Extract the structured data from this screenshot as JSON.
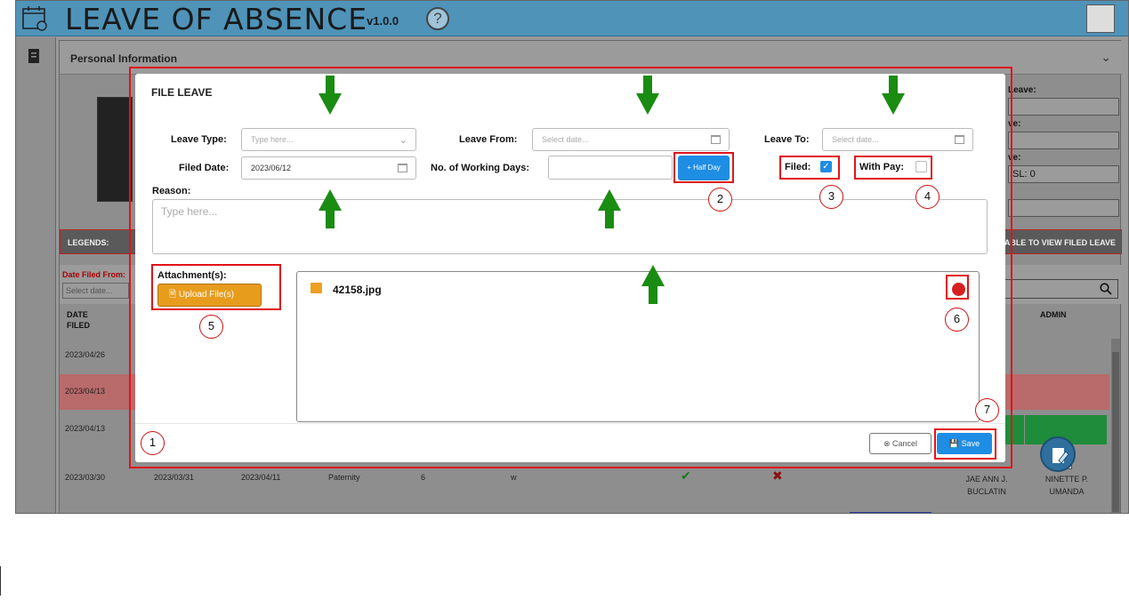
{
  "app": {
    "title": "LEAVE OF ABSENCE",
    "version": "v1.0.0",
    "help": "?"
  },
  "personal": {
    "title": "Personal Information",
    "right_labels": [
      "Leave:",
      "ve:",
      "ve:"
    ],
    "sl_value": "SL: 0"
  },
  "legends": {
    "label": "LEGENDS:",
    "hint": "TABLE TO VIEW FILED LEAVE"
  },
  "filter": {
    "label": "Date Filed From:",
    "placeholder": "Select date..."
  },
  "table": {
    "headers": {
      "date_filed": "DATE FILED",
      "admin": "ADMIN"
    },
    "rows": [
      {
        "date": "2023/04/26"
      },
      {
        "date": "2023/04/13"
      },
      {
        "date": "2023/04/13"
      },
      {
        "date": "2023/03/30",
        "from": "2023/03/31",
        "to": "2023/04/11",
        "type": "Paternity",
        "days": "6",
        "pay": "w",
        "approver": "JAE ANN J. BUCLATIN",
        "admin": "NINETTE P. UMANDA"
      }
    ]
  },
  "modal": {
    "title": "FILE LEAVE",
    "leave_type": {
      "label": "Leave Type:",
      "placeholder": "Type here..."
    },
    "leave_from": {
      "label": "Leave From:",
      "placeholder": "Select date..."
    },
    "leave_to": {
      "label": "Leave To:",
      "placeholder": "Select date..."
    },
    "filed_date": {
      "label": "Filed Date:",
      "value": "2023/06/12"
    },
    "working_days": {
      "label": "No. of Working Days:",
      "value": ""
    },
    "half_day": "+ Half Day",
    "filed": {
      "label": "Filed:",
      "checked": true
    },
    "with_pay": {
      "label": "With Pay:",
      "checked": false
    },
    "reason": {
      "label": "Reason:",
      "placeholder": "Type here..."
    },
    "attachments": {
      "label": "Attachment(s):",
      "upload": "Upload File(s)"
    },
    "file": {
      "name": "42158.jpg"
    },
    "cancel": "Cancel",
    "save": "Save"
  },
  "annotations": {
    "numbers": [
      "1",
      "2",
      "3",
      "4",
      "5",
      "6",
      "7"
    ]
  },
  "colors": {
    "header": "#4f93b9",
    "primary": "#1e8de4",
    "upload": "#e89c1c",
    "annotation": "#e0131a",
    "arrow": "#1a8c12"
  }
}
